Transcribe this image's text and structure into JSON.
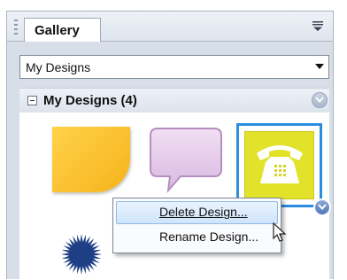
{
  "panel": {
    "tab_label": "Gallery",
    "menu_icon": "tab-menu-icon"
  },
  "dropdown": {
    "selected": "My Designs"
  },
  "section": {
    "title": "My Designs (4)",
    "collapse_icon": "collapse-minus-icon"
  },
  "gallery_items": [
    {
      "name": "sticky-note-shape",
      "color": "#f8c22e"
    },
    {
      "name": "speech-bubble-shape",
      "color": "#e3c6ea"
    },
    {
      "name": "telephone-design",
      "color": "#e2e22b"
    },
    {
      "name": "starburst-shape",
      "color": "#1e3f86"
    }
  ],
  "context_menu": {
    "items": [
      {
        "label": "Delete Design...",
        "highlighted": true
      },
      {
        "label": "Rename Design...",
        "highlighted": false
      }
    ]
  },
  "colors": {
    "selection_border": "#2b8de0",
    "menu_highlight": "#cfe4fb"
  }
}
